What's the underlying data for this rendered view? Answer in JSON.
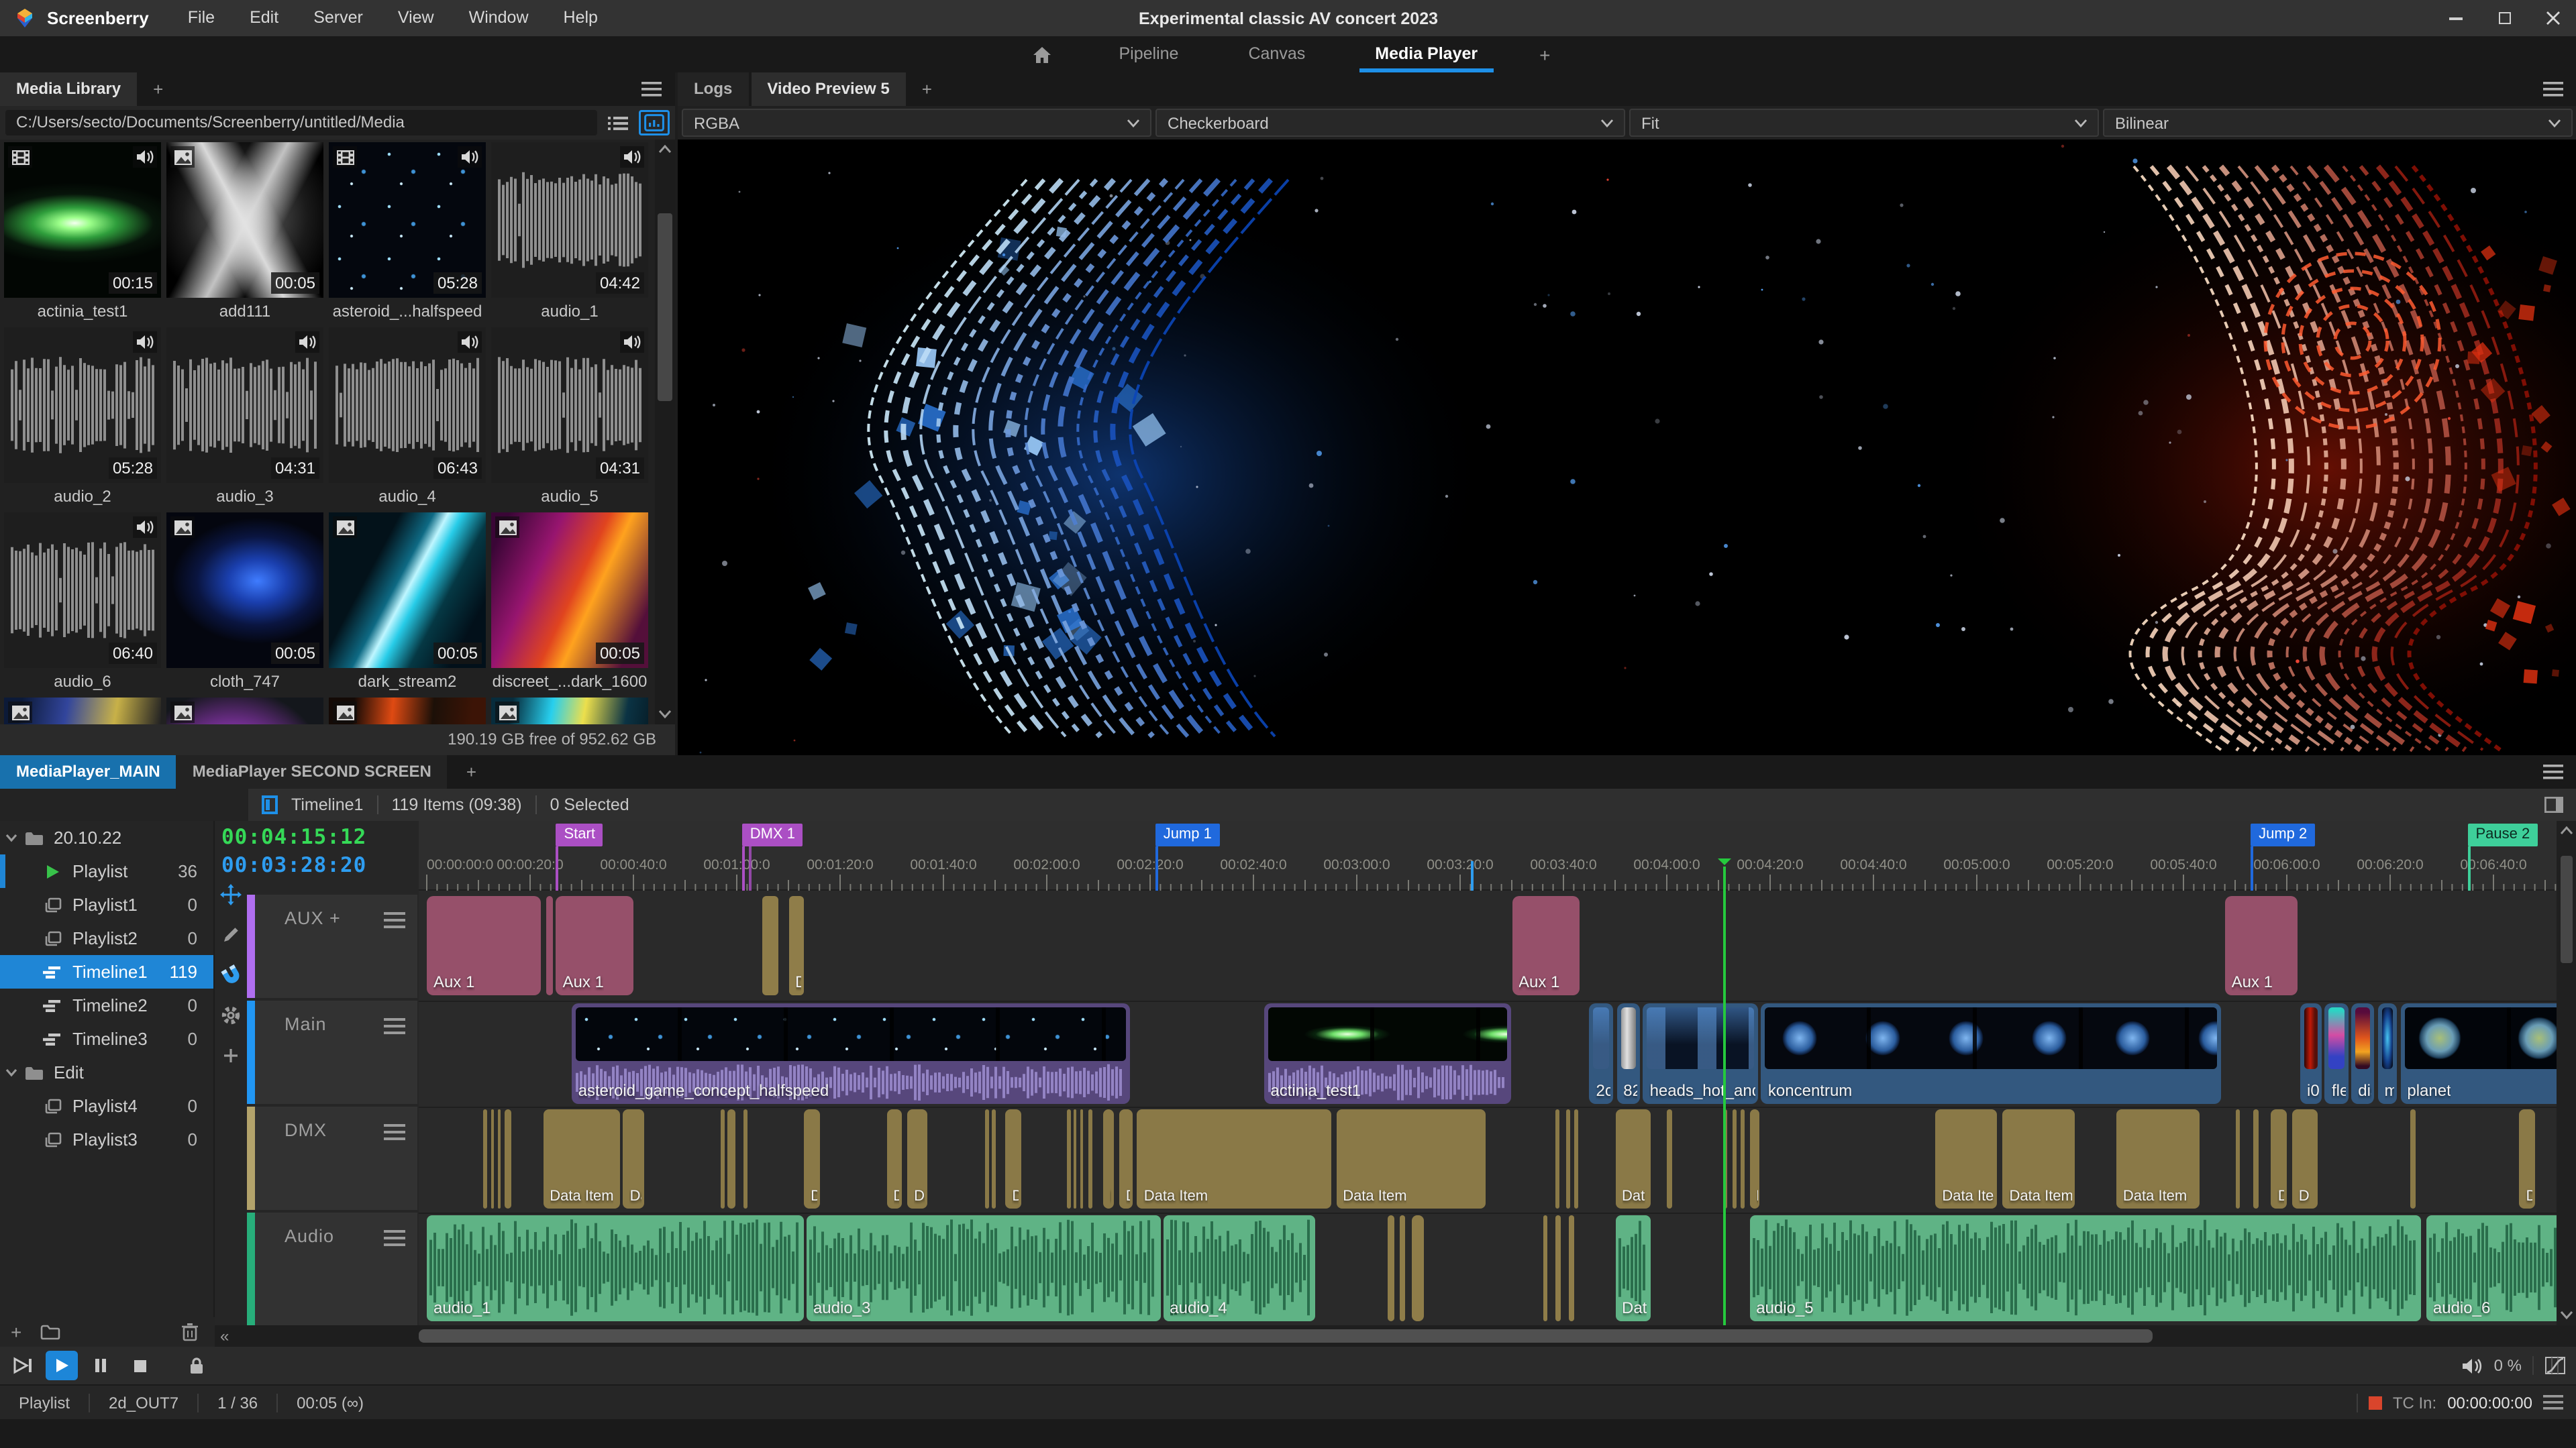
{
  "window": {
    "app_name": "Screenberry",
    "title": "Experimental classic AV concert 2023",
    "menus": [
      "File",
      "Edit",
      "Server",
      "View",
      "Window",
      "Help"
    ]
  },
  "nav": {
    "tabs": [
      "Pipeline",
      "Canvas",
      "Media Player"
    ],
    "active_tab": "Media Player",
    "add_tab": "+"
  },
  "library": {
    "tab": "Media Library",
    "add_tab": "+",
    "path": "C:/Users/secto/Documents/Screenberry/untitled/Media",
    "storage": "190.19 GB free of 952.62 GB",
    "items": [
      {
        "name": "actinia_test1",
        "duration": "00:15",
        "kind": "video",
        "has_audio": true,
        "art": "actinia"
      },
      {
        "name": "add111",
        "duration": "00:05",
        "kind": "image",
        "has_audio": false,
        "art": "add111"
      },
      {
        "name": "asteroid_...halfspeed",
        "duration": "05:28",
        "kind": "video",
        "has_audio": true,
        "art": "asteroid"
      },
      {
        "name": "audio_1",
        "duration": "04:42",
        "kind": "audio",
        "has_audio": true,
        "art": "wave"
      },
      {
        "name": "audio_2",
        "duration": "05:28",
        "kind": "audio",
        "has_audio": true,
        "art": "wave"
      },
      {
        "name": "audio_3",
        "duration": "04:31",
        "kind": "audio",
        "has_audio": true,
        "art": "wave"
      },
      {
        "name": "audio_4",
        "duration": "06:43",
        "kind": "audio",
        "has_audio": true,
        "art": "wave"
      },
      {
        "name": "audio_5",
        "duration": "04:31",
        "kind": "audio",
        "has_audio": true,
        "art": "wave"
      },
      {
        "name": "audio_6",
        "duration": "06:40",
        "kind": "audio",
        "has_audio": true,
        "art": "wave"
      },
      {
        "name": "cloth_747",
        "duration": "00:05",
        "kind": "image",
        "has_audio": false,
        "art": "cloth"
      },
      {
        "name": "dark_stream2",
        "duration": "00:05",
        "kind": "image",
        "has_audio": false,
        "art": "darkstream"
      },
      {
        "name": "discreet_...dark_1600",
        "duration": "00:05",
        "kind": "image",
        "has_audio": false,
        "art": "discreet"
      },
      {
        "name": "",
        "duration": "",
        "kind": "image",
        "has_audio": false,
        "art": "p1"
      },
      {
        "name": "",
        "duration": "",
        "kind": "image",
        "has_audio": false,
        "art": "p2"
      },
      {
        "name": "",
        "duration": "",
        "kind": "image",
        "has_audio": false,
        "art": "p3"
      },
      {
        "name": "",
        "duration": "",
        "kind": "image",
        "has_audio": false,
        "art": "p4"
      }
    ]
  },
  "preview": {
    "tabs": [
      "Logs",
      "Video Preview 5"
    ],
    "active_tab": "Video Preview 5",
    "add_tab": "+",
    "dropdowns": [
      {
        "name": "channels",
        "value": "RGBA"
      },
      {
        "name": "background",
        "value": "Checkerboard"
      },
      {
        "name": "scaling",
        "value": "Fit"
      },
      {
        "name": "filtering",
        "value": "Bilinear"
      }
    ]
  },
  "player": {
    "tabs": [
      "MediaPlayer_MAIN",
      "MediaPlayer SECOND SCREEN"
    ],
    "active_tab": "MediaPlayer_MAIN",
    "add_tab": "+",
    "header": {
      "timeline_name": "Timeline1",
      "items_info": "119 Items (09:38)",
      "selected_info": "0 Selected"
    },
    "timecode": {
      "primary": "00:04:15:12",
      "secondary": "00:03:28:20",
      "primary_color": "#35d957",
      "secondary_color": "#2e9df0"
    },
    "tree": [
      {
        "type": "folder",
        "label": "20.10.22",
        "count": "",
        "expanded": true
      },
      {
        "type": "playing",
        "label": "Playlist",
        "count": "36",
        "edge": true
      },
      {
        "type": "playlist",
        "label": "Playlist1",
        "count": "0"
      },
      {
        "type": "playlist",
        "label": "Playlist2",
        "count": "0"
      },
      {
        "type": "timeline",
        "label": "Timeline1",
        "count": "119",
        "selected": true
      },
      {
        "type": "timeline",
        "label": "Timeline2",
        "count": "0"
      },
      {
        "type": "timeline",
        "label": "Timeline3",
        "count": "0"
      },
      {
        "type": "folder",
        "label": "Edit",
        "count": "",
        "expanded": true
      },
      {
        "type": "playlist",
        "label": "Playlist4",
        "count": "0"
      },
      {
        "type": "playlist",
        "label": "Playlist3",
        "count": "0"
      }
    ],
    "tracks": [
      {
        "name": "AUX +",
        "color": "#b06ef0"
      },
      {
        "name": "Main",
        "color": "#2196f3"
      },
      {
        "name": "DMX",
        "color": "#b3a36b"
      },
      {
        "name": "Audio",
        "color": "#27ae7a"
      }
    ],
    "ruler": {
      "label_step_seconds": 20,
      "labels": [
        "00:00:00:0",
        "00:00:20:0",
        "00:00:40:0",
        "00:01:00:0",
        "00:01:20:0",
        "00:01:40:0",
        "00:02:00:0",
        "00:02:20:0",
        "00:02:40:0",
        "00:03:00:0",
        "00:03:20:0",
        "00:03:40:0",
        "00:04:00:0",
        "00:04:20:0",
        "00:04:40:0",
        "00:05:00:0",
        "00:05:20:0",
        "00:05:40:0",
        "00:06:00:0",
        "00:06:20:0",
        "00:06:40:0"
      ]
    },
    "markers": [
      {
        "label": "Start",
        "t": 25,
        "color": "#ab4fc4",
        "text_color": "#ffffff",
        "double": false
      },
      {
        "label": "DMX 1",
        "t": 61,
        "color": "#ab4fc4",
        "text_color": "#ffffff",
        "double": true
      },
      {
        "label": "Jump 1",
        "t": 141,
        "color": "#2069dd",
        "text_color": "#ffffff",
        "double": false
      },
      {
        "label": "Jump 2",
        "t": 353,
        "color": "#2069dd",
        "text_color": "#ffffff",
        "double": false
      },
      {
        "label": "Pause 2",
        "t": 395,
        "color": "#3ecf9a",
        "text_color": "#0c2a20",
        "double": false
      }
    ],
    "playhead": {
      "t": 251,
      "color": "#25c93d"
    },
    "playhead2": {
      "t": 202,
      "color": "#2e9df0"
    },
    "clips": {
      "aux": [
        {
          "label": "Aux 1",
          "s": 0,
          "e": 22
        },
        {
          "label": "",
          "s": 23,
          "e": 24.5
        },
        {
          "label": "Aux 1",
          "s": 25,
          "e": 40
        },
        {
          "label": "",
          "s": 65,
          "e": 68,
          "kind": "gold"
        },
        {
          "label": "D",
          "s": 70,
          "e": 73,
          "kind": "gold"
        },
        {
          "label": "Aux 1",
          "s": 210,
          "e": 223
        },
        {
          "label": "Aux 1",
          "s": 348,
          "e": 362
        }
      ],
      "main": [
        {
          "label": "asteroid_game_concept_halfspeed",
          "s": 28,
          "e": 136,
          "style": "purple",
          "art": "asteroid"
        },
        {
          "label": "actinia_test1",
          "s": 162,
          "e": 210,
          "style": "purple",
          "art": "actinia"
        },
        {
          "label": "2c",
          "s": 225,
          "e": 229.7,
          "style": "blue",
          "art": "heads"
        },
        {
          "label": "82",
          "s": 230.3,
          "e": 234.8,
          "style": "blue",
          "art": "gray"
        },
        {
          "label": "heads_hot_and_c",
          "s": 235.4,
          "e": 257.7,
          "style": "blue",
          "art": "heads"
        },
        {
          "label": "koncentrum",
          "s": 258.3,
          "e": 347.4,
          "style": "blue",
          "art": "spheres"
        },
        {
          "label": "i0",
          "s": 362.6,
          "e": 366.8,
          "style": "blue",
          "art": "red"
        },
        {
          "label": "fle",
          "s": 367.4,
          "e": 371.9,
          "style": "blue",
          "art": "mix"
        },
        {
          "label": "dis",
          "s": 372.5,
          "e": 376.9,
          "style": "blue",
          "art": "fire"
        },
        {
          "label": "m",
          "s": 377.6,
          "e": 381.4,
          "style": "blue",
          "art": "bluewisp"
        },
        {
          "label": "planet",
          "s": 382,
          "e": 416,
          "style": "blue",
          "art": "planet"
        }
      ],
      "dmx": [
        {
          "s": 11,
          "e": 11.6
        },
        {
          "s": 12.4,
          "e": 13
        },
        {
          "s": 13.8,
          "e": 14.4
        },
        {
          "s": 15,
          "e": 16.4
        },
        {
          "s": 22.5,
          "e": 37.5,
          "label": "Data Item"
        },
        {
          "s": 38,
          "e": 42,
          "label": "Da"
        },
        {
          "s": 57,
          "e": 57.6
        },
        {
          "s": 58.2,
          "e": 59.8
        },
        {
          "s": 61.4,
          "e": 62.2
        },
        {
          "s": 73,
          "e": 76,
          "label": "D"
        },
        {
          "s": 89,
          "e": 92,
          "label": "Ds"
        },
        {
          "s": 93,
          "e": 97,
          "label": "Da"
        },
        {
          "s": 108,
          "e": 108.8
        },
        {
          "s": 109.4,
          "e": 110.2
        },
        {
          "s": 112,
          "e": 115,
          "label": "D"
        },
        {
          "s": 124,
          "e": 124.6
        },
        {
          "s": 125.2,
          "e": 125.8
        },
        {
          "s": 126.4,
          "e": 127
        },
        {
          "s": 128,
          "e": 128.8
        },
        {
          "s": 131,
          "e": 133,
          "label": "D"
        },
        {
          "s": 134,
          "e": 136.5,
          "label": "D"
        },
        {
          "s": 137.5,
          "e": 175,
          "label": "Data Item"
        },
        {
          "s": 176,
          "e": 205,
          "label": "Data Item"
        },
        {
          "s": 218.5,
          "e": 219.3
        },
        {
          "s": 220.4,
          "e": 221.2
        },
        {
          "s": 222,
          "e": 222.8
        },
        {
          "s": 230,
          "e": 237,
          "label": "Dat"
        },
        {
          "s": 240,
          "e": 241
        },
        {
          "s": 251,
          "e": 251.8
        },
        {
          "s": 252.6,
          "e": 253.4
        },
        {
          "s": 254.2,
          "e": 255
        },
        {
          "s": 256,
          "e": 258,
          "label": "D"
        },
        {
          "s": 292,
          "e": 304,
          "label": "Data Ite"
        },
        {
          "s": 305,
          "e": 319,
          "label": "Data Item"
        },
        {
          "s": 327,
          "e": 343,
          "label": "Data Item"
        },
        {
          "s": 350,
          "e": 351
        },
        {
          "s": 353.5,
          "e": 354.5
        },
        {
          "s": 357,
          "e": 360,
          "label": "D"
        },
        {
          "s": 361,
          "e": 366,
          "label": "D"
        },
        {
          "s": 384,
          "e": 385
        },
        {
          "s": 405,
          "e": 408,
          "label": "D"
        }
      ],
      "audio": [
        {
          "label": "audio_1",
          "s": 0,
          "e": 73
        },
        {
          "label": "audio_3",
          "s": 73.5,
          "e": 142
        },
        {
          "label": "audio_4",
          "s": 142.5,
          "e": 172
        },
        {
          "label": "",
          "s": 186,
          "e": 187.2,
          "kind": "gold"
        },
        {
          "label": "",
          "s": 188.4,
          "e": 189.4,
          "kind": "gold"
        },
        {
          "label": "",
          "s": 190.6,
          "e": 193,
          "kind": "gold"
        },
        {
          "label": "",
          "s": 216,
          "e": 217,
          "kind": "gold"
        },
        {
          "label": "",
          "s": 218.5,
          "e": 219.5,
          "kind": "gold"
        },
        {
          "label": "",
          "s": 221,
          "e": 222,
          "kind": "gold"
        },
        {
          "label": "Dat",
          "s": 230,
          "e": 237
        },
        {
          "label": "audio_5",
          "s": 256,
          "e": 386
        },
        {
          "label": "audio_6",
          "s": 387,
          "e": 416
        }
      ]
    }
  },
  "footer": {
    "volume": "0 %",
    "status_items": [
      "Playlist",
      "2d_OUT7",
      "1 / 36",
      "00:05 (∞)"
    ],
    "tc_label": "TC In:",
    "tc_value": "00:00:00:00"
  }
}
